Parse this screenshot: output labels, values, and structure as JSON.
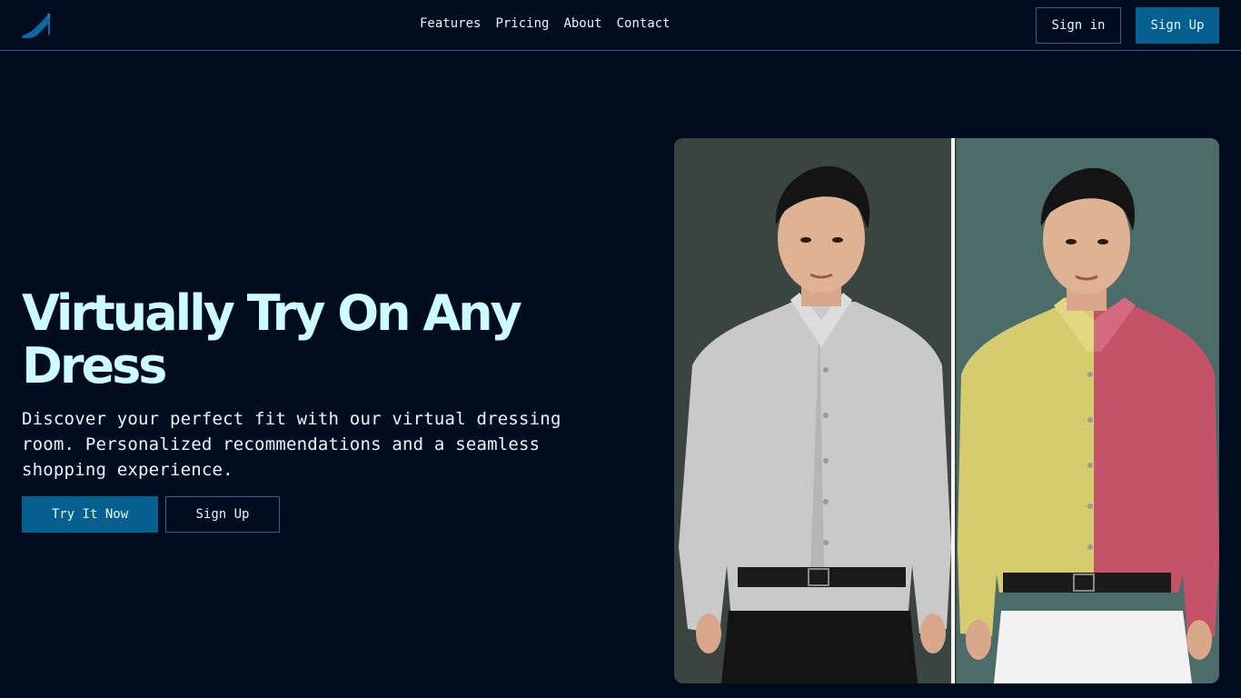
{
  "nav": {
    "links": [
      "Features",
      "Pricing",
      "About",
      "Contact"
    ],
    "sign_in": "Sign in",
    "sign_up": "Sign Up"
  },
  "hero": {
    "title": "Virtually Try On Any Dress",
    "subtitle": "Discover your perfect fit with our virtual dressing room. Personalized recommendations and a seamless shopping experience.",
    "primary_cta": "Try It Now",
    "secondary_cta": "Sign Up"
  },
  "icons": {
    "logo": "high-heel-icon"
  },
  "colors": {
    "background": "#010d1e",
    "accent": "#05608f",
    "title": "#ccfcff",
    "border": "#3a5c8a"
  }
}
